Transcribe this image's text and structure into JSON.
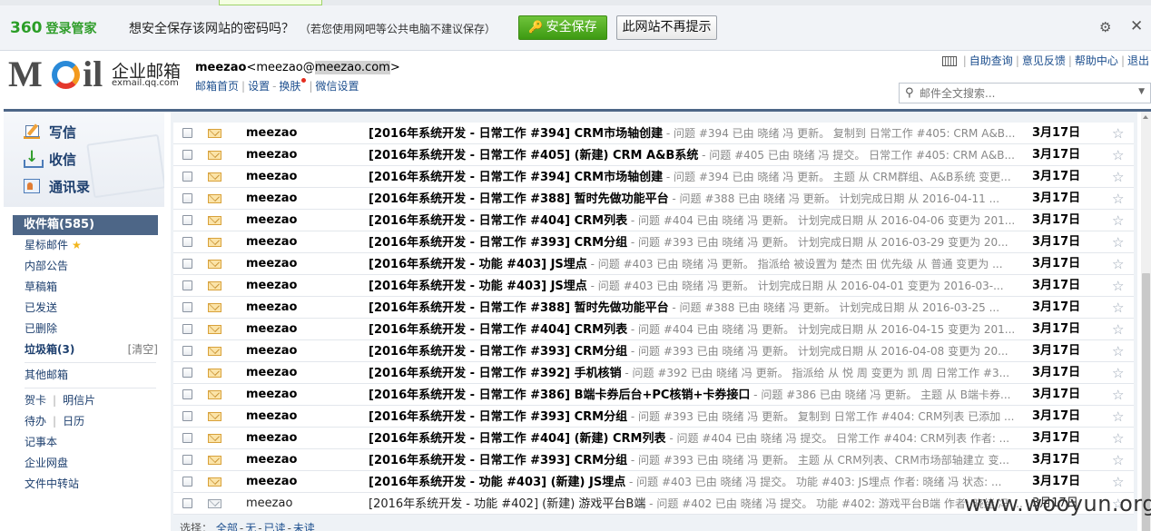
{
  "password_bar": {
    "brand_num": "360",
    "brand_text": "登录管家",
    "question": "想安全保存该网站的密码吗？",
    "hint": "（若您使用网吧等公共电脑不建议保存）",
    "save_label": "安全保存",
    "never_label": "此网站不再提示",
    "settings_icon": "gear-icon",
    "close_icon": "close-icon"
  },
  "header": {
    "logo_text_m": "M",
    "logo_text_il": "il",
    "enterprise_name": "企业邮箱",
    "enterprise_domain": "exmail.qq.com",
    "account_name": "meezao",
    "account_addr_prefix": "<meezao@",
    "account_addr_domain": "meezao.com",
    "account_addr_suffix": ">",
    "links": [
      "邮箱首页",
      "设置",
      "换肤",
      "微信设置"
    ],
    "top_links": [
      "自助查询",
      "意见反馈",
      "帮助中心",
      "退出"
    ],
    "search_placeholder": "邮件全文搜索..."
  },
  "sidebar": {
    "quick": [
      "写信",
      "收信",
      "通讯录"
    ],
    "inbox_label": "收件箱(585)",
    "folders": [
      {
        "label": "星标邮件"
      },
      {
        "label": "内部公告"
      },
      {
        "label": "草稿箱"
      },
      {
        "label": "已发送"
      },
      {
        "label": "已删除"
      },
      {
        "label": "垃圾箱(3)",
        "extra": "[清空]"
      }
    ],
    "other_mailbox": "其他邮箱",
    "pairs": [
      [
        "贺卡",
        "明信片"
      ],
      [
        "待办",
        "日历"
      ]
    ],
    "tools": [
      "记事本",
      "企业网盘",
      "文件中转站"
    ]
  },
  "mail_list": {
    "rows": [
      {
        "from": "meezao",
        "subject": "[2016年系统开发 - 日常工作 #394] CRM市场轴创建",
        "preview": " - 问题 #394 已由 晓绪 冯 更新。 复制到 日常工作 #405: CRM A&B...",
        "date": "3月17日",
        "read": false
      },
      {
        "from": "meezao",
        "subject": "[2016年系统开发 - 日常工作 #405] (新建) CRM A&B系统",
        "preview": " - 问题 #405 已由 晓绪 冯 提交。 日常工作 #405: CRM A&B...",
        "date": "3月17日",
        "read": false
      },
      {
        "from": "meezao",
        "subject": "[2016年系统开发 - 日常工作 #394] CRM市场轴创建",
        "preview": " - 问题 #394 已由 晓绪 冯 更新。 主题 从 CRM群组、A&B系统 变更...",
        "date": "3月17日",
        "read": false
      },
      {
        "from": "meezao",
        "subject": "[2016年系统开发 - 日常工作 #388] 暂时先做功能平台",
        "preview": " - 问题 #388 已由 晓绪 冯 更新。 计划完成日期 从 2016-04-11 ...",
        "date": "3月17日",
        "read": false
      },
      {
        "from": "meezao",
        "subject": "[2016年系统开发 - 日常工作 #404] CRM列表",
        "preview": " - 问题 #404 已由 晓绪 冯 更新。 计划完成日期 从 2016-04-06 变更为 201...",
        "date": "3月17日",
        "read": false
      },
      {
        "from": "meezao",
        "subject": "[2016年系统开发 - 日常工作 #393] CRM分组",
        "preview": " - 问题 #393 已由 晓绪 冯 更新。 计划完成日期 从 2016-03-29 变更为 20...",
        "date": "3月17日",
        "read": false
      },
      {
        "from": "meezao",
        "subject": "[2016年系统开发 - 功能 #403] JS埋点",
        "preview": " - 问题 #403 已由 晓绪 冯 更新。 指派给 被设置为 楚杰 田 优先级 从 普通 变更为 ...",
        "date": "3月17日",
        "read": false
      },
      {
        "from": "meezao",
        "subject": "[2016年系统开发 - 功能 #403] JS埋点",
        "preview": " - 问题 #403 已由 晓绪 冯 更新。 计划完成日期 从 2016-04-01 变更为 2016-03-...",
        "date": "3月17日",
        "read": false
      },
      {
        "from": "meezao",
        "subject": "[2016年系统开发 - 日常工作 #388] 暂时先做功能平台",
        "preview": " - 问题 #388 已由 晓绪 冯 更新。 计划完成日期 从 2016-03-25 ...",
        "date": "3月17日",
        "read": false
      },
      {
        "from": "meezao",
        "subject": "[2016年系统开发 - 日常工作 #404] CRM列表",
        "preview": " - 问题 #404 已由 晓绪 冯 更新。 计划完成日期 从 2016-04-15 变更为 201...",
        "date": "3月17日",
        "read": false
      },
      {
        "from": "meezao",
        "subject": "[2016年系统开发 - 日常工作 #393] CRM分组",
        "preview": " - 问题 #393 已由 晓绪 冯 更新。 计划完成日期 从 2016-04-08 变更为 20...",
        "date": "3月17日",
        "read": false
      },
      {
        "from": "meezao",
        "subject": "[2016年系统开发 - 日常工作 #392] 手机核销",
        "preview": " - 问题 #392 已由 晓绪 冯 更新。 指派给 从 悦 周 变更为 凯 周 日常工作 #3...",
        "date": "3月17日",
        "read": false
      },
      {
        "from": "meezao",
        "subject": "[2016年系统开发 - 日常工作 #386] B端卡券后台+PC核销+卡券接口",
        "preview": " - 问题 #386 已由 晓绪 冯 更新。 主题 从 B端卡券...",
        "date": "3月17日",
        "read": false
      },
      {
        "from": "meezao",
        "subject": "[2016年系统开发 - 日常工作 #393] CRM分组",
        "preview": " - 问题 #393 已由 晓绪 冯 更新。 复制到 日常工作 #404: CRM列表 已添加 ...",
        "date": "3月17日",
        "read": false
      },
      {
        "from": "meezao",
        "subject": "[2016年系统开发 - 日常工作 #404] (新建) CRM列表",
        "preview": " - 问题 #404 已由 晓绪 冯 提交。 日常工作 #404: CRM列表 作者: ...",
        "date": "3月17日",
        "read": false
      },
      {
        "from": "meezao",
        "subject": "[2016年系统开发 - 日常工作 #393] CRM分组",
        "preview": " - 问题 #393 已由 晓绪 冯 更新。 主题 从 CRM列表、CRM市场部轴建立 变...",
        "date": "3月17日",
        "read": false
      },
      {
        "from": "meezao",
        "subject": "[2016年系统开发 - 功能 #403] (新建) JS埋点",
        "preview": " - 问题 #403 已由 晓绪 冯 提交。 功能 #403: JS埋点 作者: 晓绪 冯 状态: ...",
        "date": "3月17日",
        "read": false
      },
      {
        "from": "meezao",
        "subject": "[2016年系统开发 - 功能 #402] (新建) 游戏平台B端",
        "preview": " - 问题 #402 已由 晓绪 冯 提交。 功能 #402: 游戏平台B端 作者: 晓绪 冯 ...",
        "date": "3月17日",
        "read": true
      }
    ],
    "select_label": "选择：",
    "select_options": [
      "全部",
      "无",
      "已读",
      "未读"
    ]
  },
  "watermark": "www.wooyun.org"
}
